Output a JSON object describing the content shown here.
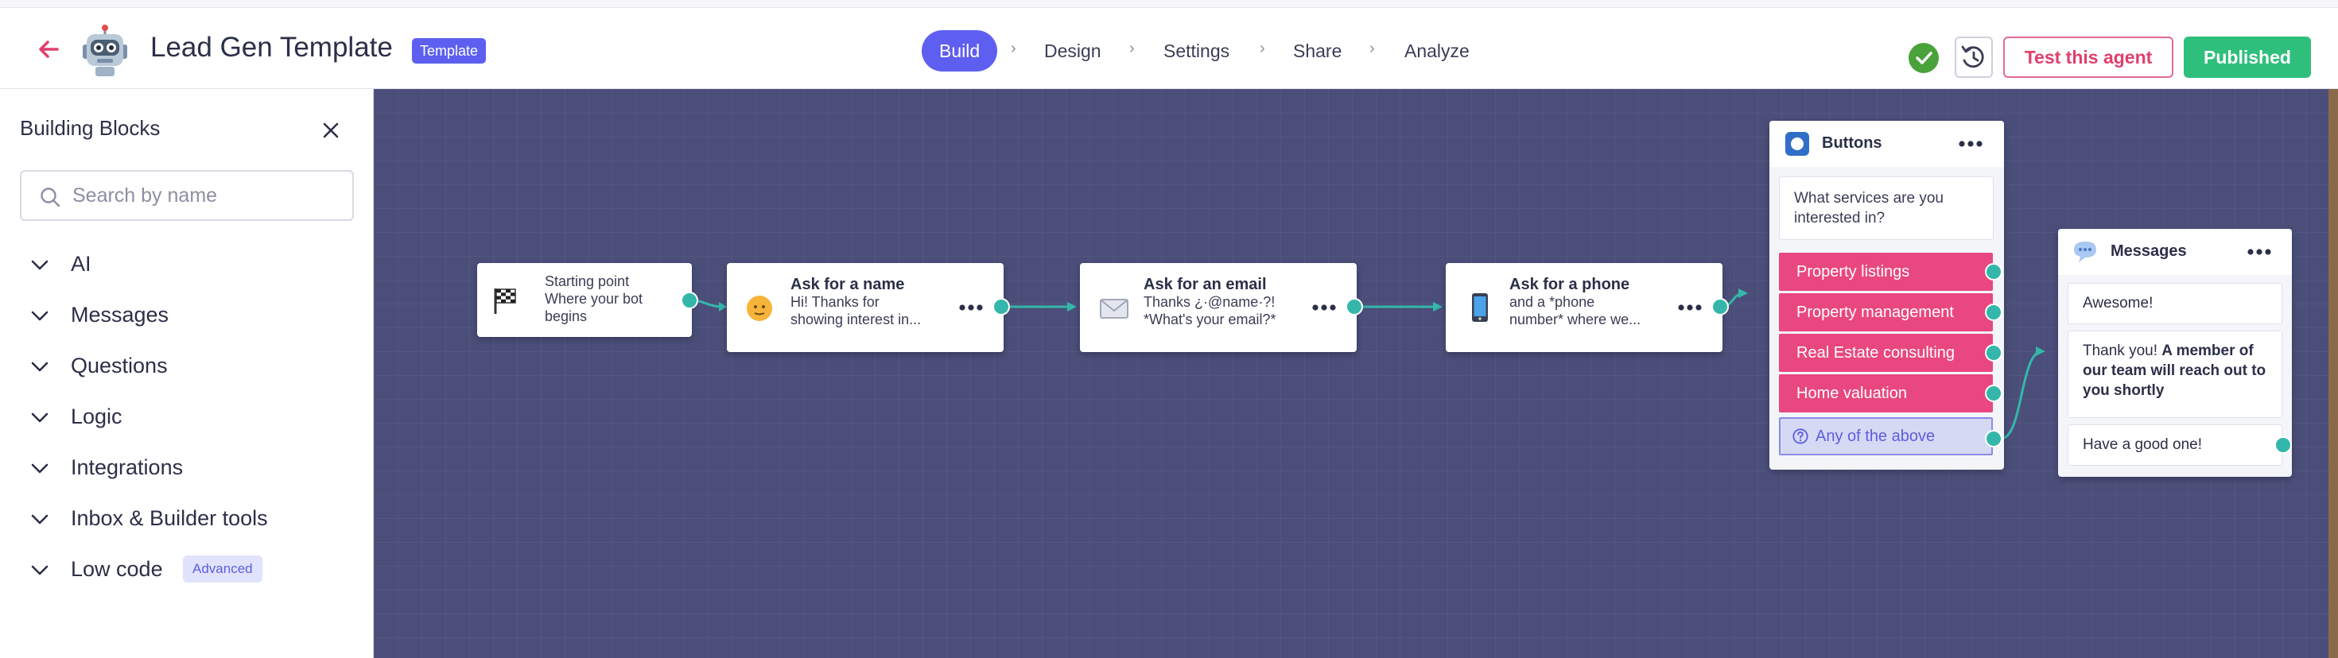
{
  "header": {
    "title": "Lead Gen Template",
    "badge": "Template",
    "steps": [
      "Build",
      "Design",
      "Settings",
      "Share",
      "Analyze"
    ],
    "step_separator": "›",
    "test_button": "Test this agent",
    "publish_button": "Published"
  },
  "sidebar": {
    "title": "Building Blocks",
    "search_placeholder": "Search by name",
    "categories": [
      "AI",
      "Messages",
      "Questions",
      "Logic",
      "Integrations",
      "Inbox & Builder tools",
      "Low code"
    ],
    "advanced_badge": "Advanced"
  },
  "canvas": {
    "start": {
      "line1": "Starting point",
      "line2": "Where your bot",
      "line3": "begins"
    },
    "name_node": {
      "title": "Ask for a name",
      "line1": "Hi! Thanks for",
      "line2": "showing interest in..."
    },
    "email_node": {
      "title": "Ask for an email",
      "line1": "Thanks ¿·@name·?!",
      "line2": "*What's your email?*"
    },
    "phone_node": {
      "title": "Ask for a phone",
      "line1": "and a *phone",
      "line2": "number* where we..."
    },
    "buttons_node": {
      "title": "Buttons",
      "question": "What services are you interested in?",
      "choices": [
        "Property listings",
        "Property management",
        "Real Estate consulting",
        "Home valuation"
      ],
      "other_choice": "Any of the above"
    },
    "messages_node": {
      "title": "Messages",
      "msg1": "Awesome!",
      "msg2_prefix": "Thank you!",
      "msg2_bold": "A member of our team will reach out to you shortly",
      "msg3": "Have a good one!"
    }
  },
  "colors": {
    "accent": "#5e5ff0",
    "canvas_bg": "#4a4e79",
    "connector": "#34b7aa",
    "choice_bg": "#e9477f",
    "publish_bg": "#2fbf7c",
    "test_text": "#e03f6c"
  },
  "icons": {
    "back": "arrow-left-icon",
    "avatar": "robot-icon",
    "status": "check-circle-icon",
    "history": "history-icon",
    "close": "close-icon",
    "search": "search-icon",
    "expand": "chevron-down-icon",
    "start": "checkered-flag-icon",
    "name": "face-icon",
    "email": "envelope-icon",
    "phone": "mobile-phone-icon",
    "buttons": "button-square-icon",
    "messages": "speech-bubble-icon",
    "menu": "more-dots-icon"
  }
}
